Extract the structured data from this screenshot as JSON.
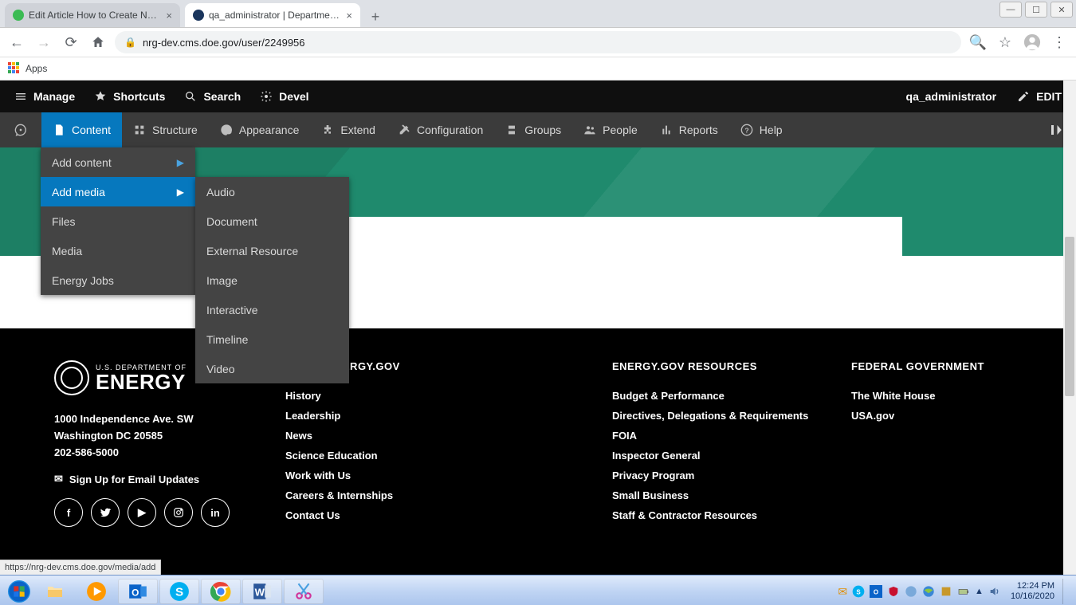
{
  "browser": {
    "tabs": [
      {
        "title": "Edit Article How to Create New M",
        "favColor": "#3bbb53"
      },
      {
        "title": "qa_administrator | Department o",
        "favColor": "#1b365d"
      }
    ],
    "url": "nrg-dev.cms.doe.gov/user/2249956",
    "appsLabel": "Apps",
    "statusUrl": "https://nrg-dev.cms.doe.gov/media/add"
  },
  "toolbar": {
    "manage": "Manage",
    "shortcuts": "Shortcuts",
    "search": "Search",
    "devel": "Devel",
    "user": "qa_administrator",
    "edit": "EDIT"
  },
  "adminMenu": {
    "items": [
      "Content",
      "Structure",
      "Appearance",
      "Extend",
      "Configuration",
      "Groups",
      "People",
      "Reports",
      "Help"
    ],
    "active": "Content"
  },
  "contentMenu": {
    "items": [
      {
        "label": "Add content",
        "hasSub": true
      },
      {
        "label": "Add media",
        "hasSub": true,
        "hover": true
      },
      {
        "label": "Files"
      },
      {
        "label": "Media"
      },
      {
        "label": "Energy Jobs"
      }
    ]
  },
  "mediaMenu": [
    "Audio",
    "Document",
    "External Resource",
    "Image",
    "Interactive",
    "Timeline",
    "Video"
  ],
  "footer": {
    "dept": "U.S. DEPARTMENT OF",
    "brand": "ENERGY",
    "addr1": "1000 Independence Ave. SW",
    "addr2": "Washington DC 20585",
    "phone": "202-586-5000",
    "signup": "Sign Up for Email Updates",
    "col1": {
      "title": "ABOUT ENERGY.GOV",
      "links": [
        "History",
        "Leadership",
        "News",
        "Science Education",
        "Work with Us",
        "Careers & Internships",
        "Contact Us"
      ]
    },
    "col2": {
      "title": "ENERGY.GOV RESOURCES",
      "links": [
        "Budget & Performance",
        "Directives, Delegations & Requirements",
        "FOIA",
        "Inspector General",
        "Privacy Program",
        "Small Business",
        "Staff & Contractor Resources"
      ]
    },
    "col3": {
      "title": "FEDERAL GOVERNMENT",
      "links": [
        "The White House",
        "USA.gov"
      ]
    },
    "socials": [
      "f",
      "t",
      "yt",
      "ig",
      "in"
    ]
  },
  "system": {
    "time": "12:24 PM",
    "date": "10/16/2020"
  }
}
